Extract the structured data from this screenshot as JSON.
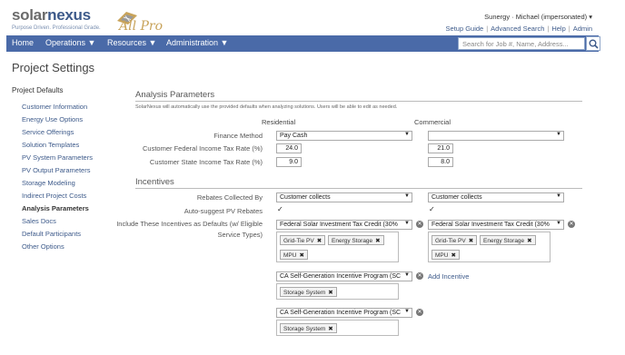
{
  "brand": {
    "part1": "solar",
    "part2": "nexus",
    "tagline": "Purpose Driven. Professional Grade.",
    "tier": "All Pro"
  },
  "user": {
    "display": "Sunergy · Michael (impersonated) ▾"
  },
  "top_links": [
    "Setup Guide",
    "Advanced Search",
    "Help",
    "Admin"
  ],
  "nav": {
    "home": "Home",
    "operations": "Operations ▼",
    "resources": "Resources ▼",
    "administration": "Administration ▼"
  },
  "search": {
    "placeholder": "Search for Job #, Name, Address..."
  },
  "page_title": "Project Settings",
  "sidebar": {
    "title": "Project Defaults",
    "items": [
      "Customer Information",
      "Energy Use Options",
      "Service Offerings",
      "Solution Templates",
      "PV System Parameters",
      "PV Output Parameters",
      "Storage Modeling",
      "Indirect Project Costs",
      "Analysis Parameters",
      "Sales Docs",
      "Default Participants",
      "Other Options"
    ],
    "active_index": 8
  },
  "analysis": {
    "heading": "Analysis Parameters",
    "note": "SolarNexus will automatically use the provided defaults when analyzing solutions. Users will be able to edit as needed.",
    "col_residential": "Residential",
    "col_commercial": "Commercial",
    "finance_label": "Finance Method",
    "finance_res": "Pay Cash",
    "finance_com": "",
    "federal_label": "Customer Federal Income Tax Rate (%)",
    "federal_res": "24.0",
    "federal_com": "21.0",
    "state_label": "Customer State Income Tax Rate (%)",
    "state_res": "9.0",
    "state_com": "8.0"
  },
  "incentives": {
    "heading": "Incentives",
    "rebates_label": "Rebates Collected By",
    "rebates_res": "Customer collects",
    "rebates_com": "Customer collects",
    "auto_label": "Auto-suggest PV Rebates",
    "check_mark": "✓",
    "include_label": "Include These Incentives as Defaults (w/ Eligible Service Types)",
    "res_incentive1": "Federal Solar Investment Tax Credit (30%",
    "com_incentive1": "Federal Solar Investment Tax Credit (30%",
    "res_tags1": [
      "Grid-Tie PV",
      "Energy Storage",
      "MPU"
    ],
    "com_tags1": [
      "Grid-Tie PV",
      "Energy Storage",
      "MPU"
    ],
    "res_incentive2": "CA Self-Generation Incentive Program (SC",
    "res_tags2": [
      "Storage System"
    ],
    "res_incentive3": "CA Self-Generation Incentive Program (SC",
    "res_tags3": [
      "Storage System"
    ],
    "add_incentive": "Add Incentive",
    "tag_remove": "✖",
    "remove_glyph": "✕"
  },
  "colors": {
    "nav_bg": "#4a6aa8",
    "link": "#3d5a8a",
    "accent_gold": "#c8a35a"
  }
}
